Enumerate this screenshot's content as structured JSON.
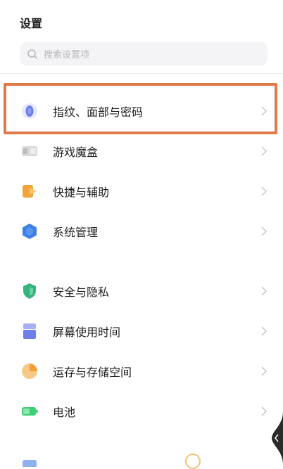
{
  "header": {
    "title": "设置"
  },
  "search": {
    "placeholder": "搜索设置项"
  },
  "group1": [
    {
      "label": "指纹、面部与密码",
      "icon": "fingerprint-icon",
      "color": "#6a7cf0"
    },
    {
      "label": "游戏魔盒",
      "icon": "game-box-icon",
      "color": "#c9c9c9"
    },
    {
      "label": "快捷与辅助",
      "icon": "shortcut-icon",
      "color": "#f2a33a"
    },
    {
      "label": "系统管理",
      "icon": "system-management-icon",
      "color": "#3c7fe6"
    }
  ],
  "group2": [
    {
      "label": "安全与隐私",
      "icon": "shield-icon",
      "color": "#36b37e"
    },
    {
      "label": "屏幕使用时间",
      "icon": "screen-time-icon",
      "color": "#6f7fe8"
    },
    {
      "label": "运存与存储空间",
      "icon": "storage-icon",
      "color": "#f0a03b"
    },
    {
      "label": "电池",
      "icon": "battery-icon",
      "color": "#3fcf72"
    }
  ],
  "highlight_color": "#e07a4c"
}
